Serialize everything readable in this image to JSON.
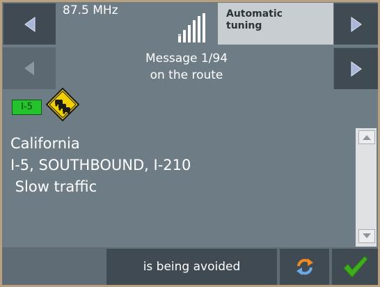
{
  "radio": {
    "frequency": "87.5 MHz",
    "mode_line1": "Automatic",
    "mode_line2": "tuning",
    "signal_icon": "signal-strength-icon"
  },
  "message": {
    "line1": "Message 1/94",
    "line2": "on the route"
  },
  "event": {
    "road_badge": "I-5",
    "sign_icon": "traffic-jam-warning-icon",
    "location": "California",
    "road": "I-5, SOUTHBOUND, I-210",
    "description": " Slow traffic"
  },
  "footer": {
    "avoid_label": "is being avoided",
    "refresh_icon": "refresh-icon",
    "ok_icon": "checkmark-icon"
  },
  "colors": {
    "background": "#6e7c86",
    "frame": "#b9a07e",
    "button_dark": "#3f4a53",
    "badge_green": "#24c22c",
    "sign_yellow": "#f2d000",
    "check_green": "#3fae1c"
  }
}
